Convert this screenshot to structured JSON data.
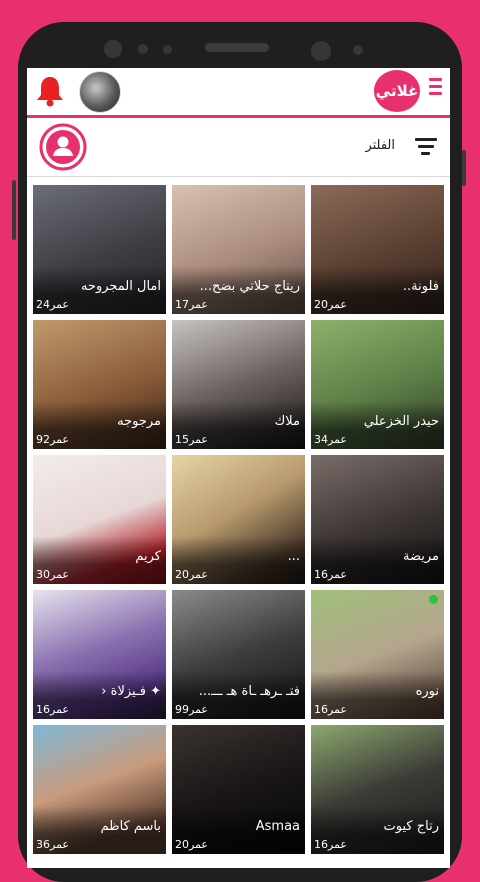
{
  "app": {
    "logo_text": "غلاتي",
    "accent_color": "#e8306f",
    "menu_icon": "hamburger-menu-icon",
    "notification_icon": "bell-icon"
  },
  "filter": {
    "label": "الفلتر",
    "icon": "filter-icon",
    "profile_icon": "user-circle-icon"
  },
  "users": [
    {
      "name": "فلونة..",
      "age": "20عمر",
      "online": false
    },
    {
      "name": "ريتاج حلاتي بضح...",
      "age": "17عمر",
      "online": false
    },
    {
      "name": "امال المجروحه",
      "age": "24عمر",
      "online": false
    },
    {
      "name": "حيدر الخزعلي",
      "age": "34عمر",
      "online": false
    },
    {
      "name": "ملاك",
      "age": "15عمر",
      "online": false
    },
    {
      "name": "مرجوجه",
      "age": "92عمر",
      "online": false
    },
    {
      "name": "مريضة",
      "age": "16عمر",
      "online": false
    },
    {
      "name": "...",
      "age": "20عمر",
      "online": false
    },
    {
      "name": "كريم",
      "age": "30عمر",
      "online": false
    },
    {
      "name": "نوره",
      "age": "16عمر",
      "online": true
    },
    {
      "name": "فتـ ـرهـ ـاة هـ ـــ...",
      "age": "99عمر",
      "online": false
    },
    {
      "name": "✦ فـيزلاة ‹",
      "age": "16عمر",
      "online": false
    },
    {
      "name": "رتاج كيوت",
      "age": "16عمر",
      "online": false
    },
    {
      "name": "Asmaa",
      "age": "20عمر",
      "online": false
    },
    {
      "name": "باسم كاظم",
      "age": "36عمر",
      "online": false
    }
  ]
}
